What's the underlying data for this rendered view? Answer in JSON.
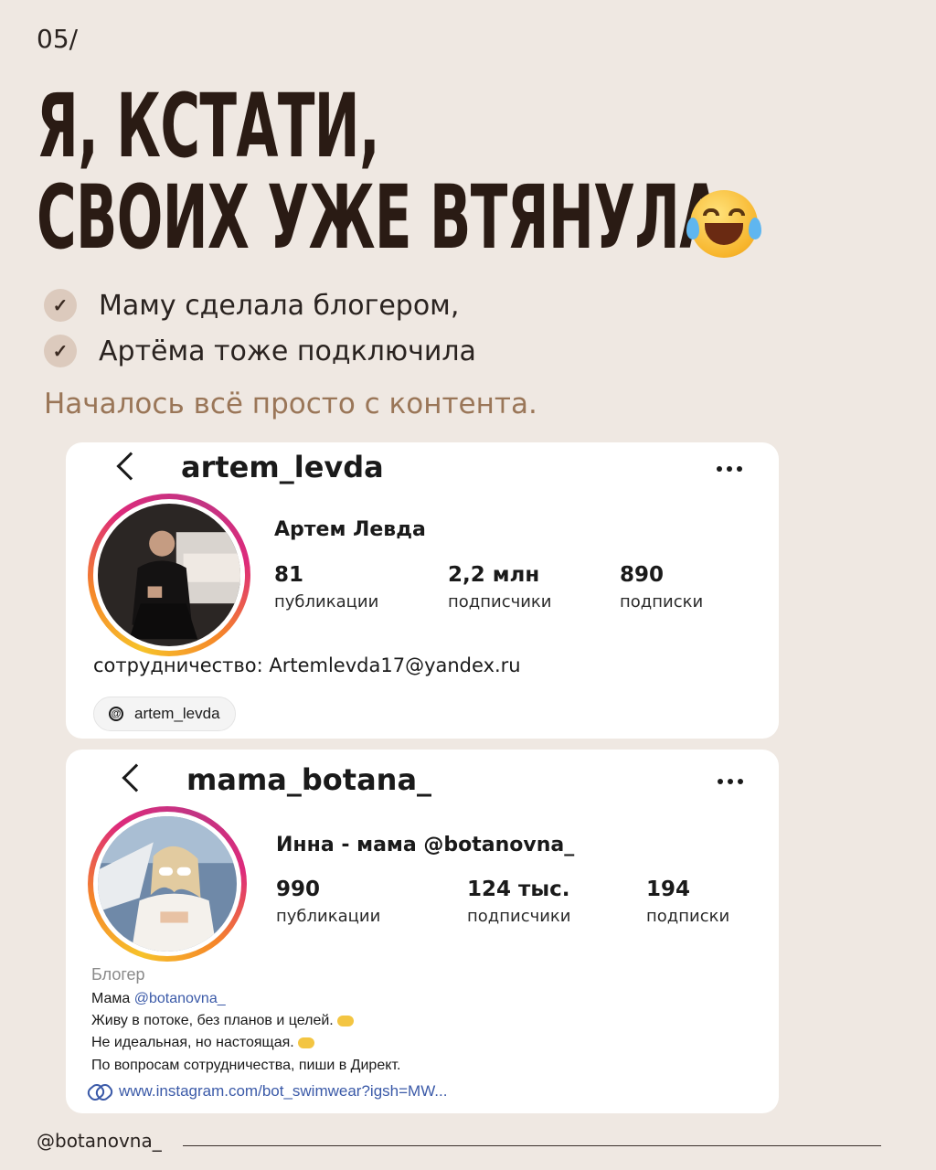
{
  "slide_number": "05/",
  "headline": {
    "line1": "Я, КСТАТИ,",
    "line2": "СВОИХ УЖЕ ВТЯНУЛА",
    "emoji": "face-with-tears-of-joy-icon"
  },
  "checklist": [
    {
      "text": "Маму сделала блогером,",
      "icon": "checkmark-icon"
    },
    {
      "text": "Артёма тоже подключила",
      "icon": "checkmark-icon"
    }
  ],
  "subtitle": "Началось всё просто с контента.",
  "profile1": {
    "handle": "artem_levda",
    "display_name": "Артем Левда",
    "stats": [
      {
        "value": "81",
        "label": "публикации"
      },
      {
        "value": "2,2 млн",
        "label": "подписчики"
      },
      {
        "value": "890",
        "label": "подписки"
      }
    ],
    "contact": "сотрудничество: Artemlevda17@yandex.ru",
    "threads_handle": "artem_levda"
  },
  "profile2": {
    "handle": "mama_botana_",
    "display_name": "Инна   - мама @botanovna_",
    "stats": [
      {
        "value": "990",
        "label": "публикации"
      },
      {
        "value": "124 тыс.",
        "label": "подписчики"
      },
      {
        "value": "194",
        "label": "подписки"
      }
    ],
    "category": "Блогер",
    "bio_prefix": "Мама ",
    "bio_mention": "@botanovna_",
    "bio_line2": "Живу в потоке, без планов и целей.",
    "bio_line3": "Не идеальная, но настоящая.",
    "bio_line4": "По вопросам сотрудничества, пиши в Директ.",
    "link": "www.instagram.com/bot_swimwear?igsh=MW..."
  },
  "footer": {
    "handle": "@botanovna_"
  },
  "colors": {
    "background": "#efe8e2",
    "headline": "#2a1b14",
    "subtitle": "#9a7658",
    "check_bg": "#dccabd",
    "link": "#3b5aa8"
  }
}
